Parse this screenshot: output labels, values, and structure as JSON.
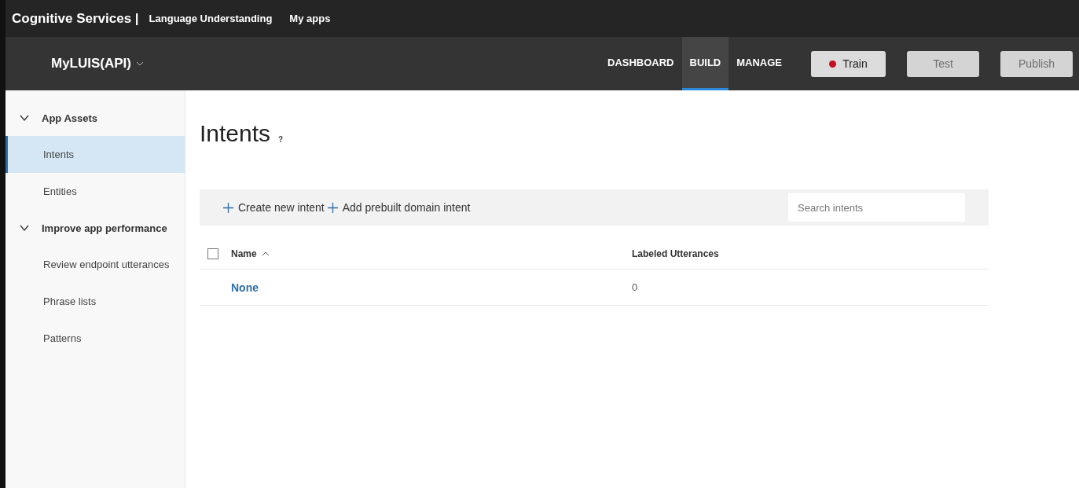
{
  "header": {
    "brand": "Cognitive Services |",
    "product": "Language Understanding",
    "link": "My apps"
  },
  "app_bar": {
    "app_name": "MyLUIS(API)",
    "nav": [
      {
        "label": "DASHBOARD",
        "selected": false
      },
      {
        "label": "BUILD",
        "selected": true
      },
      {
        "label": "MANAGE",
        "selected": false
      }
    ],
    "buttons": [
      {
        "label": "Train",
        "disabled": false,
        "color": "#c50f1f"
      },
      {
        "label": "Test",
        "disabled": true
      },
      {
        "label": "Publish",
        "disabled": true
      }
    ]
  },
  "sidebar": {
    "sections": [
      {
        "label": "App Assets",
        "expanded": true,
        "children": [
          {
            "label": "Intents",
            "selected": true
          },
          {
            "label": "Entities",
            "selected": false
          }
        ]
      },
      {
        "label": "Improve app performance",
        "expanded": true,
        "children": [
          {
            "label": "Review endpoint utterances",
            "selected": false
          },
          {
            "label": "Phrase lists",
            "selected": false
          },
          {
            "label": "Patterns",
            "selected": false
          }
        ]
      }
    ]
  },
  "page": {
    "title": "Intents",
    "help": "?",
    "toolbar": {
      "actions": [
        "Create new intent",
        "Add prebuilt domain intent"
      ],
      "search": {
        "placeholder": "Search intents"
      }
    },
    "table": {
      "select_all": {
        "checked": false
      },
      "columns": [
        "Name",
        "Labeled Utterances"
      ],
      "rows": [
        [
          "None",
          "0"
        ]
      ]
    }
  }
}
